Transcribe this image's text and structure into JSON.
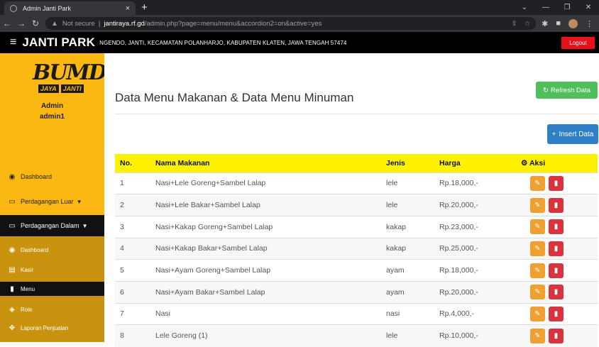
{
  "browser": {
    "tab_title": "Admin Janti Park",
    "tab_close": "×",
    "new_tab": "+",
    "url_warning": "Not secure",
    "url_host": "jantiraya.rf.gd",
    "url_path": "/admin.php?page=menu/menu&accordion2=on&active=yes"
  },
  "header": {
    "menu_icon": "≡",
    "brand": "JANTI PARK",
    "address": "NGENDO, JANTI, KECAMATAN POLANHARJO, KABUPATEN KLATEN, JAWA TENGAH 57474",
    "logout": "Logout"
  },
  "sidebar": {
    "logo_text": "BUMDesa",
    "logo_plate_1": "JAYA",
    "logo_plate_2": "JANTI",
    "role": "Admin",
    "username": "admin1",
    "items": [
      {
        "label": "Dashboard",
        "icon": "tachometer-icon"
      },
      {
        "label": "Perdagangan Luar",
        "icon": "desktop-icon"
      },
      {
        "label": "Perdagangan Dalam",
        "icon": "desktop-icon"
      }
    ],
    "sub_items": [
      {
        "label": "Dashboard",
        "icon": "tachometer-icon"
      },
      {
        "label": "Kasir",
        "icon": "cashier-icon"
      },
      {
        "label": "Menu",
        "icon": "clipboard-icon"
      },
      {
        "label": "Role",
        "icon": "layers-icon"
      },
      {
        "label": "Laporan Penjualan",
        "icon": "handshake-icon"
      }
    ]
  },
  "main": {
    "title": "Data Menu Makanan & Data Menu Minuman",
    "refresh_label": "Refresh Data",
    "insert_label": "Insert Data",
    "columns": [
      "No.",
      "Nama Makanan",
      "Jenis",
      "Harga",
      "Aksi"
    ],
    "rows": [
      {
        "no": "1",
        "nama": "Nasi+Lele Goreng+Sambel Lalap",
        "jenis": "lele",
        "harga": "Rp.18,000,-"
      },
      {
        "no": "2",
        "nama": "Nasi+Lele Bakar+Sambel Lalap",
        "jenis": "lele",
        "harga": "Rp.20,000,-"
      },
      {
        "no": "3",
        "nama": "Nasi+Kakap Goreng+Sambel Lalap",
        "jenis": "kakap",
        "harga": "Rp.23,000,-"
      },
      {
        "no": "4",
        "nama": "Nasi+Kakap Bakar+Sambel Lalap",
        "jenis": "kakap",
        "harga": "Rp.25,000,-"
      },
      {
        "no": "5",
        "nama": "Nasi+Ayam Goreng+Sambel Lalap",
        "jenis": "ayam",
        "harga": "Rp.18,000,-"
      },
      {
        "no": "6",
        "nama": "Nasi+Ayam Bakar+Sambel Lalap",
        "jenis": "ayam",
        "harga": "Rp.20,000,-"
      },
      {
        "no": "7",
        "nama": "Nasi",
        "jenis": "nasi",
        "harga": "Rp.4,000,-"
      },
      {
        "no": "8",
        "nama": "Lele Goreng (1)",
        "jenis": "lele",
        "harga": "Rp.10,000,-"
      }
    ]
  },
  "colors": {
    "sidebar": "#fcb812",
    "header_row": "#fff200",
    "refresh": "#4fbe5b",
    "insert": "#2e7fc6",
    "edit": "#f0a030",
    "delete": "#d9343d",
    "logout": "#e8101a"
  }
}
